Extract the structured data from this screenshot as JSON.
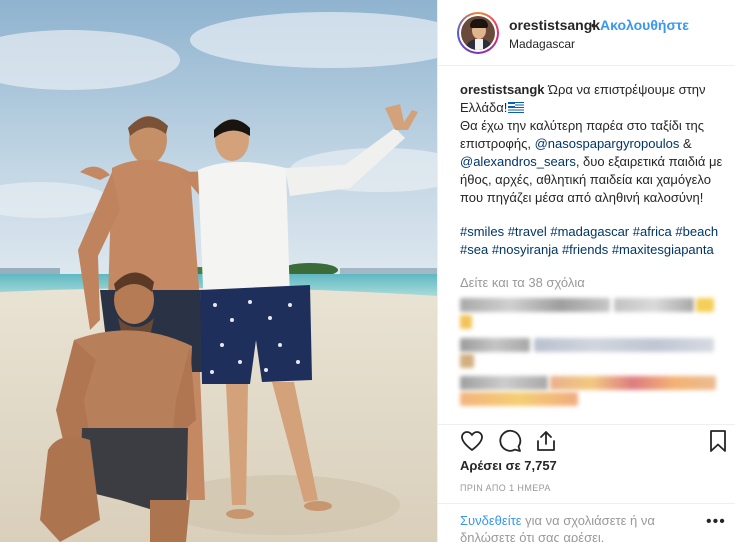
{
  "post": {
    "username": "orestistsangk",
    "dot": "•",
    "follow_label": "Ακολουθήστε",
    "location": "Madagascar"
  },
  "caption": {
    "username": "orestistsangk",
    "line1": "Ώρα να επιστρέψουμε στην Ελλάδα!",
    "flag_icon": "greek-flag-icon",
    "line2_a": "Θα έχω την καλύτερη παρέα στο ταξίδι της επιστροφής,",
    "mention1": "@nasospapargyropoulos",
    "amp": "&",
    "mention2": "@alexandros_sears",
    "line2_b": ", δυο εξαιρετικά παιδιά με ήθος, αρχές, αθλητική παιδεία και χαμόγελο που πηγάζει μέσα από αληθινή καλοσύνη!",
    "hashtags": [
      "#smiles",
      "#travel",
      "#madagascar",
      "#africa",
      "#beach",
      "#sea",
      "#nosyiranja",
      "#friends",
      "#maxitesgiapanta"
    ]
  },
  "comments": {
    "view_all": "Δείτε και τα 38 σχόλια"
  },
  "actions": {
    "like_icon": "heart-icon",
    "comment_icon": "comment-icon",
    "share_icon": "share-icon",
    "save_icon": "bookmark-icon"
  },
  "stats": {
    "likes": "Αρέσει σε 7,757",
    "time": "ΠΡΙΝ ΑΠΟ 1 ΗΜΕΡΑ"
  },
  "footer": {
    "login_link": "Συνδεθείτε",
    "login_text": " για να σχολιάσετε ή να δηλώσετε ότι σας αρέσει.",
    "more_icon": "more-options-icon"
  },
  "colors": {
    "link_blue": "#3897f0",
    "mention_blue": "#003569",
    "muted_gray": "#999999",
    "text": "#262626"
  }
}
